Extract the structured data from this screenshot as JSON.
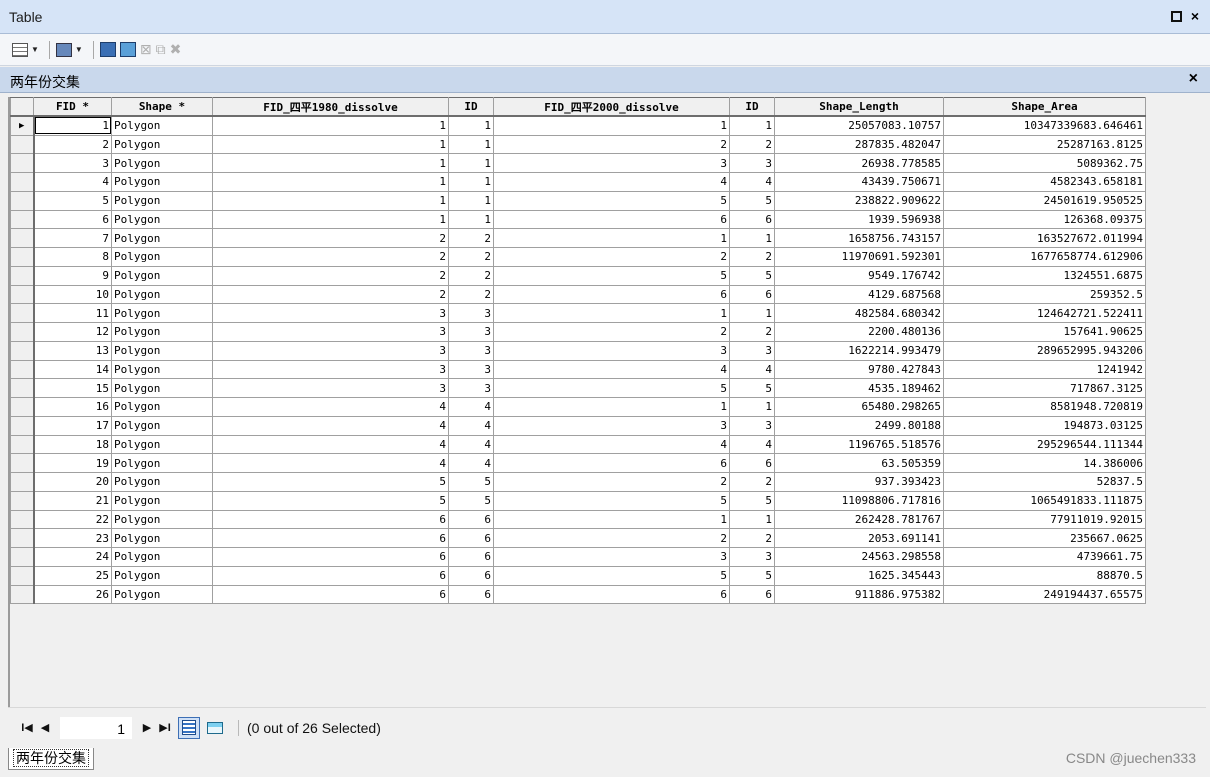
{
  "window": {
    "title": "Table",
    "restore_label": "",
    "close_label": "×"
  },
  "toolbar": {
    "icons": [
      "table-options-icon",
      "related-tables-icon",
      "select-by-attributes-icon",
      "switch-selection-icon",
      "clear-selection-icon",
      "zoom-to-selected-icon",
      "delete-selected-icon"
    ]
  },
  "tab": {
    "name": "两年份交集",
    "close_label": "×"
  },
  "table": {
    "columns": [
      "FID *",
      "Shape *",
      "FID_四平1980_dissolve",
      "ID",
      "FID_四平2000_dissolve",
      "ID",
      "Shape_Length",
      "Shape_Area"
    ],
    "rows": [
      [
        "1",
        "Polygon",
        "1",
        "1",
        "1",
        "1",
        "25057083.10757",
        "10347339683.646461"
      ],
      [
        "2",
        "Polygon",
        "1",
        "1",
        "2",
        "2",
        "287835.482047",
        "25287163.8125"
      ],
      [
        "3",
        "Polygon",
        "1",
        "1",
        "3",
        "3",
        "26938.778585",
        "5089362.75"
      ],
      [
        "4",
        "Polygon",
        "1",
        "1",
        "4",
        "4",
        "43439.750671",
        "4582343.658181"
      ],
      [
        "5",
        "Polygon",
        "1",
        "1",
        "5",
        "5",
        "238822.909622",
        "24501619.950525"
      ],
      [
        "6",
        "Polygon",
        "1",
        "1",
        "6",
        "6",
        "1939.596938",
        "126368.09375"
      ],
      [
        "7",
        "Polygon",
        "2",
        "2",
        "1",
        "1",
        "1658756.743157",
        "163527672.011994"
      ],
      [
        "8",
        "Polygon",
        "2",
        "2",
        "2",
        "2",
        "11970691.592301",
        "1677658774.612906"
      ],
      [
        "9",
        "Polygon",
        "2",
        "2",
        "5",
        "5",
        "9549.176742",
        "1324551.6875"
      ],
      [
        "10",
        "Polygon",
        "2",
        "2",
        "6",
        "6",
        "4129.687568",
        "259352.5"
      ],
      [
        "11",
        "Polygon",
        "3",
        "3",
        "1",
        "1",
        "482584.680342",
        "124642721.522411"
      ],
      [
        "12",
        "Polygon",
        "3",
        "3",
        "2",
        "2",
        "2200.480136",
        "157641.90625"
      ],
      [
        "13",
        "Polygon",
        "3",
        "3",
        "3",
        "3",
        "1622214.993479",
        "289652995.943206"
      ],
      [
        "14",
        "Polygon",
        "3",
        "3",
        "4",
        "4",
        "9780.427843",
        "1241942"
      ],
      [
        "15",
        "Polygon",
        "3",
        "3",
        "5",
        "5",
        "4535.189462",
        "717867.3125"
      ],
      [
        "16",
        "Polygon",
        "4",
        "4",
        "1",
        "1",
        "65480.298265",
        "8581948.720819"
      ],
      [
        "17",
        "Polygon",
        "4",
        "4",
        "3",
        "3",
        "2499.80188",
        "194873.03125"
      ],
      [
        "18",
        "Polygon",
        "4",
        "4",
        "4",
        "4",
        "1196765.518576",
        "295296544.111344"
      ],
      [
        "19",
        "Polygon",
        "4",
        "4",
        "6",
        "6",
        "63.505359",
        "14.386006"
      ],
      [
        "20",
        "Polygon",
        "5",
        "5",
        "2",
        "2",
        "937.393423",
        "52837.5"
      ],
      [
        "21",
        "Polygon",
        "5",
        "5",
        "5",
        "5",
        "11098806.717816",
        "1065491833.111875"
      ],
      [
        "22",
        "Polygon",
        "6",
        "6",
        "1",
        "1",
        "262428.781767",
        "77911019.92015"
      ],
      [
        "23",
        "Polygon",
        "6",
        "6",
        "2",
        "2",
        "2053.691141",
        "235667.0625"
      ],
      [
        "24",
        "Polygon",
        "6",
        "6",
        "3",
        "3",
        "24563.298558",
        "4739661.75"
      ],
      [
        "25",
        "Polygon",
        "6",
        "6",
        "5",
        "5",
        "1625.345443",
        "88870.5"
      ],
      [
        "26",
        "Polygon",
        "6",
        "6",
        "6",
        "6",
        "911886.975382",
        "249194437.65575"
      ]
    ]
  },
  "navigation": {
    "first": "I◀",
    "prev": "◀",
    "current_record": "1",
    "next": "▶",
    "last": "▶I",
    "selection_status": "(0 out of 26 Selected)"
  },
  "bottom_tab": {
    "name": "两年份交集"
  },
  "watermark": "CSDN @juechen333"
}
